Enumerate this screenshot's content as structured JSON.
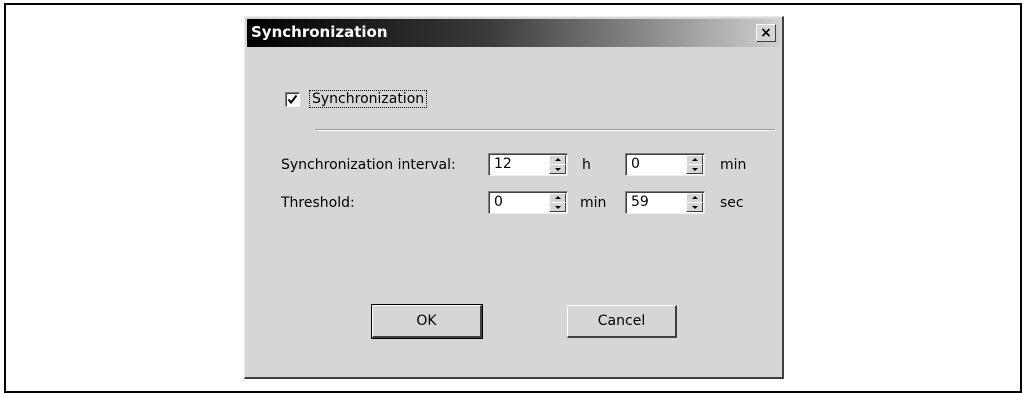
{
  "dialog": {
    "title": "Synchronization",
    "close_label": "×",
    "checkbox": {
      "label": "Synchronization",
      "checked": true
    },
    "interval": {
      "label": "Synchronization interval:",
      "hours": "12",
      "hours_unit": "h",
      "minutes": "0",
      "minutes_unit": "min"
    },
    "threshold": {
      "label": "Threshold:",
      "minutes": "0",
      "minutes_unit": "min",
      "seconds": "59",
      "seconds_unit": "sec"
    },
    "ok_label": "OK",
    "cancel_label": "Cancel"
  }
}
